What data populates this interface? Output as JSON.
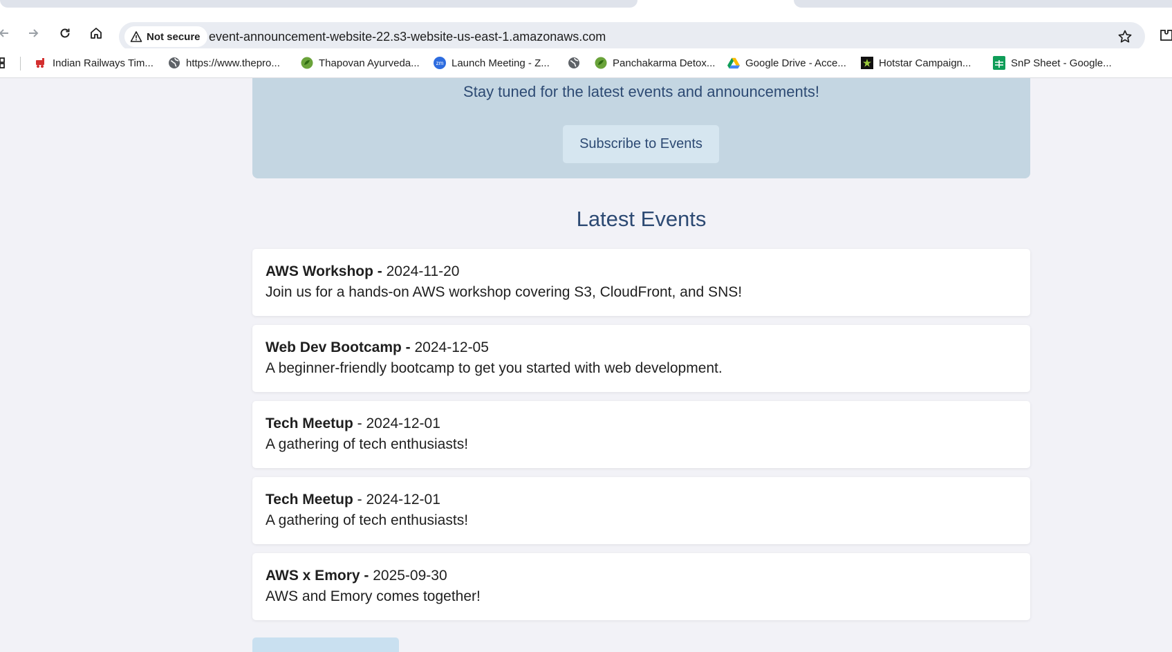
{
  "browser": {
    "url": "event-announcement-website-22.s3-website-us-east-1.amazonaws.com",
    "security_label": "Not secure",
    "bookmarks": [
      {
        "label": "Indian Railways Tim...",
        "icon": "train-icon"
      },
      {
        "label": "https://www.thepro...",
        "icon": "globe-icon"
      },
      {
        "label": "Thapovan Ayurveda...",
        "icon": "leaf-icon"
      },
      {
        "label": "Launch Meeting - Z...",
        "icon": "zoom-icon"
      },
      {
        "label": "",
        "icon": "globe-icon"
      },
      {
        "label": "Panchakarma Detox...",
        "icon": "leaf-icon"
      },
      {
        "label": "Google Drive - Acce...",
        "icon": "google-drive-icon"
      },
      {
        "label": "Hotstar Campaign...",
        "icon": "hotstar-icon"
      },
      {
        "label": "SnP Sheet - Google...",
        "icon": "google-sheets-icon"
      }
    ]
  },
  "hero": {
    "tagline": "Stay tuned for the latest events and announcements!",
    "subscribe_label": "Subscribe to Events"
  },
  "events_section": {
    "title": "Latest Events",
    "separator": " - ",
    "events": [
      {
        "name": "AWS Workshop",
        "date": "2024-11-20",
        "description": "Join us for a hands-on AWS workshop covering S3, CloudFront, and SNS!"
      },
      {
        "name": "Web Dev Bootcamp",
        "date": "2024-12-05",
        "description": "A beginner-friendly bootcamp to get you started with web development."
      },
      {
        "name": "Tech Meetup",
        "date": "2024-12-01",
        "description": "A gathering of tech enthusiasts!"
      },
      {
        "name": "Tech Meetup",
        "date": "2024-12-01",
        "description": "A gathering of tech enthusiasts!"
      },
      {
        "name": "AWS x Emory",
        "date": "2025-09-30",
        "description": "AWS and Emory comes together!"
      }
    ]
  },
  "colors": {
    "page_bg": "#f2f2f7",
    "hero_bg": "#c4d6e2",
    "accent_text": "#2d4a73"
  }
}
